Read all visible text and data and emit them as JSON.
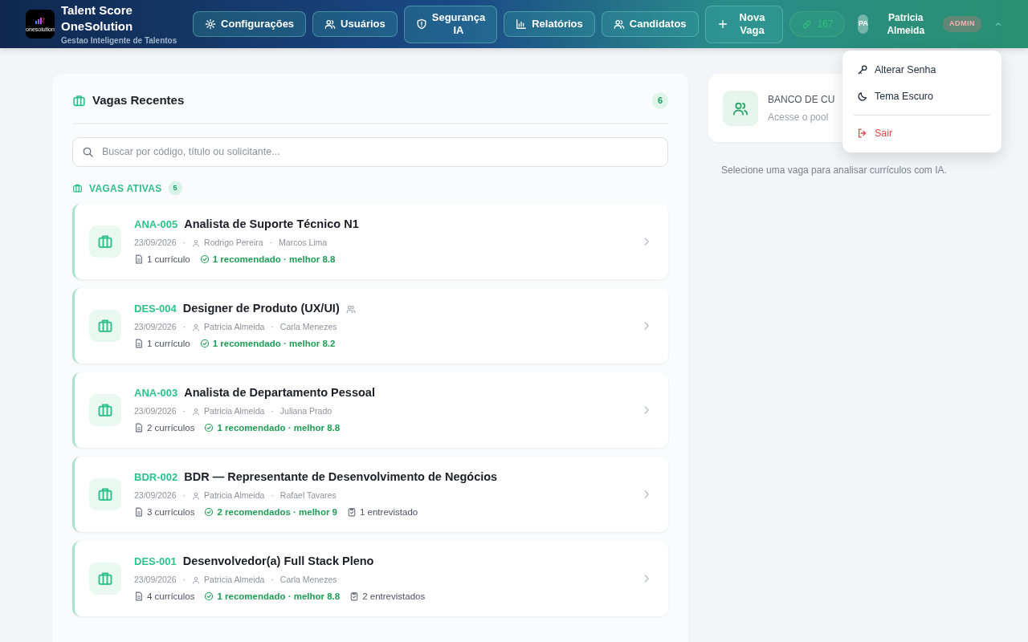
{
  "brand": {
    "logo_text": "onesolution",
    "title_line1": "Talent Score",
    "title_line2": "OneSolution",
    "subtitle": "Gestao Inteligente de Talentos"
  },
  "nav": [
    {
      "label": "Configurações"
    },
    {
      "label": "Usuários"
    },
    {
      "label": "Segurança IA"
    },
    {
      "label": "Relatórios"
    },
    {
      "label": "Candidatos"
    },
    {
      "label": "Nova Vaga"
    }
  ],
  "credits": "167",
  "user": {
    "initials": "PA",
    "name": "Patricia Almeida",
    "role": "ADMIN",
    "menu_open": true
  },
  "user_menu": [
    {
      "label": "Alterar Senha",
      "kind": "normal"
    },
    {
      "label": "Tema Escuro",
      "kind": "normal"
    },
    {
      "label": "Sair",
      "kind": "danger"
    }
  ],
  "panel": {
    "title": "Vagas Recentes",
    "count": "6",
    "search_placeholder": "Buscar por código, título ou solicitante...",
    "section_title": "VAGAS ATIVAS",
    "section_count": "5"
  },
  "jobs": [
    {
      "code": "ANA-005",
      "title": "Analista de Suporte Técnico N1",
      "shared": false,
      "date": "23/09/2026",
      "sep1": "·",
      "requester": "Rodrigo Pereira",
      "sep2": "·",
      "recruiter": "Marcos Lima",
      "resumes": "1 currículo",
      "recommended": "1 recomendado · melhor 8.8"
    },
    {
      "code": "DES-004",
      "title": "Designer de Produto (UX/UI)",
      "shared": true,
      "date": "23/09/2026",
      "sep1": "·",
      "requester": "Patricia Almeida",
      "sep2": "·",
      "recruiter": "Carla Menezes",
      "resumes": "1 currículo",
      "recommended": "1 recomendado · melhor 8.2"
    },
    {
      "code": "ANA-003",
      "title": "Analista de Departamento Pessoal",
      "shared": false,
      "date": "23/09/2026",
      "sep1": "·",
      "requester": "Patricia Almeida",
      "sep2": "·",
      "recruiter": "Juliana Prado",
      "resumes": "2 currículos",
      "recommended": "1 recomendado · melhor 8.8"
    },
    {
      "code": "BDR-002",
      "title": "BDR — Representante de Desenvolvimento de Negócios",
      "shared": false,
      "date": "23/09/2026",
      "sep1": "·",
      "requester": "Patricia Almeida",
      "sep2": "·",
      "recruiter": "Rafael Tavares",
      "resumes": "3 currículos",
      "recommended": "2 recomendados · melhor 9",
      "interviewed": "1 entrevistado"
    },
    {
      "code": "DES-001",
      "title": "Desenvolvedor(a) Full Stack Pleno",
      "shared": false,
      "date": "23/09/2026",
      "sep1": "·",
      "requester": "Patricia Almeida",
      "sep2": "·",
      "recruiter": "Carla Menezes",
      "resumes": "4 currículos",
      "recommended": "1 recomendado · melhor 8.8",
      "interviewed": "2 entrevistados"
    }
  ],
  "pool_card": {
    "title": "BANCO DE CU",
    "subtitle": "Acesse o pool"
  },
  "hint": "Selecione uma vaga para analisar currículos com IA."
}
